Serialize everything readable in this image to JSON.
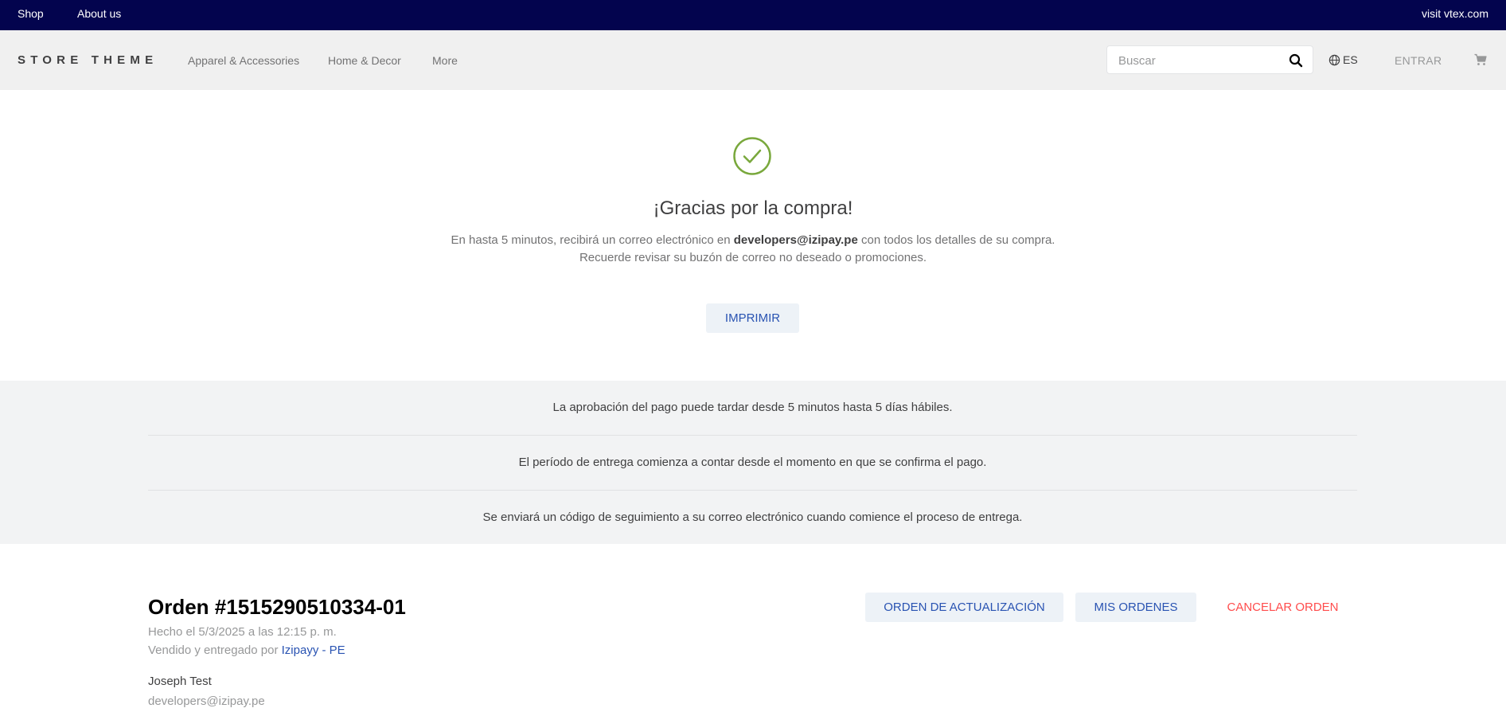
{
  "topbar": {
    "shop": "Shop",
    "about": "About us",
    "visit": "visit vtex.com"
  },
  "header": {
    "logo": "STORE THEME",
    "nav": [
      "Apparel & Accessories",
      "Home & Decor",
      "More"
    ],
    "search_placeholder": "Buscar",
    "language": "ES",
    "login": "ENTRAR"
  },
  "confirmation": {
    "title": "¡Gracias por la compra!",
    "line1_prefix": "En hasta 5 minutos, recibirá un correo electrónico en ",
    "email": "developers@izipay.pe",
    "line1_suffix": " con todos los detalles de su compra.",
    "line2": "Recuerde revisar su buzón de correo no deseado o promociones.",
    "print_label": "IMPRIMIR"
  },
  "info": [
    "La aprobación del pago puede tardar desde 5 minutos hasta 5 días hábiles.",
    "El período de entrega comienza a contar desde el momento en que se confirma el pago.",
    "Se enviará un código de seguimiento a su correo electrónico cuando comience el proceso de entrega."
  ],
  "order": {
    "title": "Orden #1515290510334-01",
    "date": "Hecho el 5/3/2025 a las 12:15 p. m.",
    "seller_prefix": "Vendido y entregado por ",
    "seller_name": "Izipayy - PE",
    "customer_name": "Joseph Test",
    "customer_email": "developers@izipay.pe",
    "update_label": "ORDEN DE ACTUALIZACIÓN",
    "my_orders_label": "MIS ORDENES",
    "cancel_label": "CANCELAR ORDEN"
  },
  "colors": {
    "topbar": "#03044e",
    "accent_blue": "#2953b2",
    "success_green": "#79a83c",
    "danger_red": "#ff4c4c"
  },
  "icons": [
    "search-icon",
    "globe-icon",
    "cart-icon",
    "check-circle-icon"
  ]
}
